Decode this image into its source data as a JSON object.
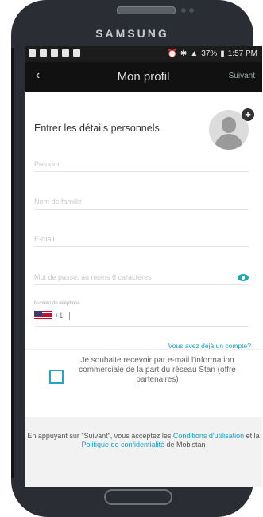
{
  "device": {
    "brand": "SAMSUNG"
  },
  "status_bar": {
    "battery": "37%",
    "time": "1:57 PM"
  },
  "app_bar": {
    "back_glyph": "‹",
    "title": "Mon profil",
    "next_label": "Suivant"
  },
  "form": {
    "heading": "Entrer les détails personnels",
    "first_name_placeholder": "Prénom",
    "last_name_placeholder": "Nom de famille",
    "email_placeholder": "E-mail",
    "password_placeholder": "Mot de passe, au moins 6 caractères",
    "phone_label": "Numéro de téléphone",
    "phone_code": "+1",
    "account_link": "Vous avez déjà un compte?"
  },
  "opt_in": {
    "text": "Je souhaite recevoir par e-mail l'information commerciale de la part du réseau Stan (offre partenaires)",
    "checked": false
  },
  "legal": {
    "prefix": "En appuyant sur \"Suivant\", vous acceptez les ",
    "terms_link": "Conditions d'utilisation",
    "middle": " et la ",
    "privacy_link": "Politique de confidentialité",
    "suffix": " de Mobistan"
  },
  "colors": {
    "accent": "#1aa0c2",
    "app_bar": "#111111"
  }
}
